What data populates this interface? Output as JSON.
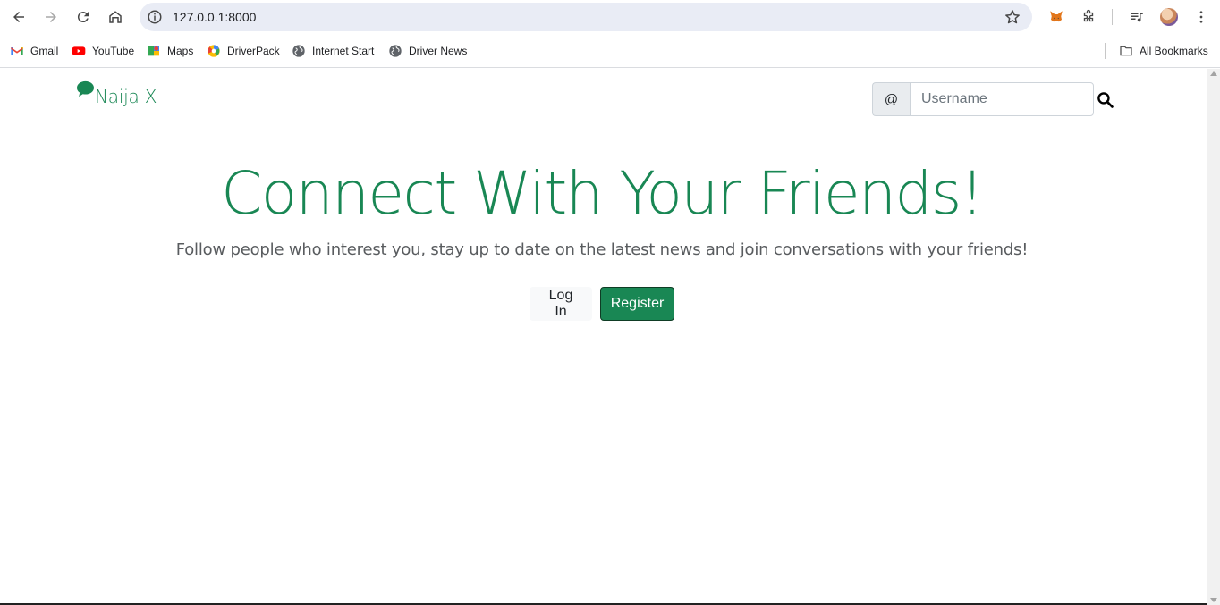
{
  "browser": {
    "url": "127.0.0.1:8000",
    "bookmarks": [
      {
        "label": "Gmail",
        "icon": "gmail-icon"
      },
      {
        "label": "YouTube",
        "icon": "youtube-icon"
      },
      {
        "label": "Maps",
        "icon": "maps-icon"
      },
      {
        "label": "DriverPack",
        "icon": "driverpack-icon"
      },
      {
        "label": "Internet Start",
        "icon": "globe-icon"
      },
      {
        "label": "Driver News",
        "icon": "globe-icon"
      }
    ],
    "all_bookmarks_label": "All Bookmarks"
  },
  "navbar": {
    "brand": "Naija X",
    "search": {
      "prefix": "@",
      "placeholder": "Username",
      "value": ""
    }
  },
  "hero": {
    "title": "Connect With Your Friends!",
    "subtitle": "Follow people who interest you, stay up to date on the latest news and join conversations with your friends!",
    "login_label": "Log In",
    "register_label": "Register"
  },
  "colors": {
    "brand": "#198754",
    "text_muted": "#595c5f"
  }
}
